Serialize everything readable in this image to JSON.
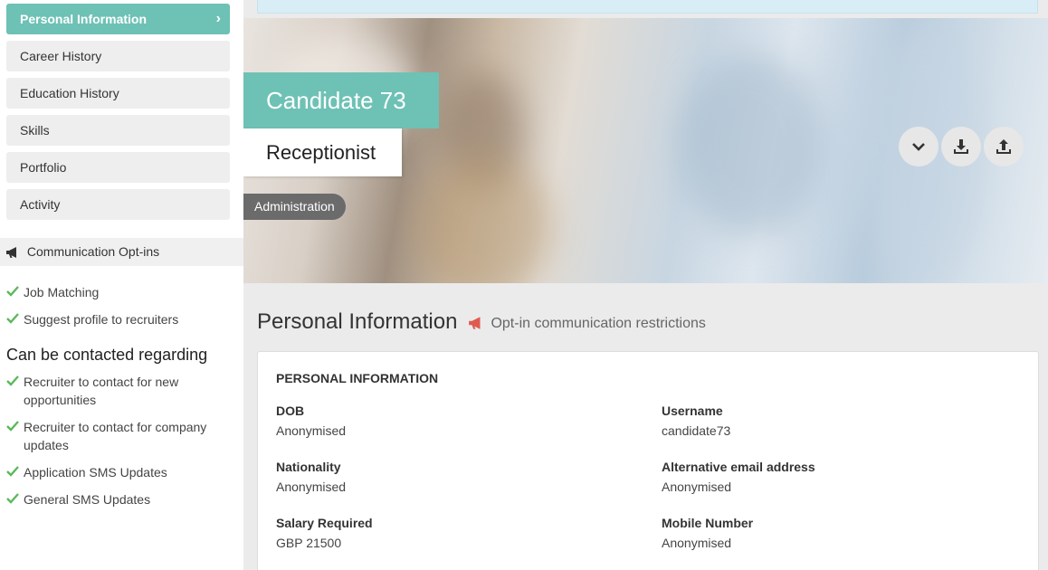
{
  "sidebar": {
    "nav": [
      {
        "label": "Personal Information",
        "active": true
      },
      {
        "label": "Career History",
        "active": false
      },
      {
        "label": "Education History",
        "active": false
      },
      {
        "label": "Skills",
        "active": false
      },
      {
        "label": "Portfolio",
        "active": false
      },
      {
        "label": "Activity",
        "active": false
      }
    ],
    "optins_title": "Communication Opt-ins",
    "optins": [
      "Job Matching",
      "Suggest profile to recruiters"
    ],
    "contact_title": "Can be contacted regarding",
    "contact_items": [
      "Recruiter to contact for new opportunities",
      "Recruiter to contact for company updates",
      "Application SMS Updates",
      "General SMS Updates"
    ]
  },
  "hero": {
    "name": "Candidate 73",
    "role": "Receptionist",
    "tag": "Administration"
  },
  "section": {
    "title": "Personal Information",
    "subtitle": "Opt-in communication restrictions"
  },
  "card": {
    "title": "PERSONAL INFORMATION",
    "fields": [
      {
        "label": "DOB",
        "value": "Anonymised"
      },
      {
        "label": "Username",
        "value": "candidate73"
      },
      {
        "label": "Nationality",
        "value": "Anonymised"
      },
      {
        "label": "Alternative email address",
        "value": "Anonymised"
      },
      {
        "label": "Salary Required",
        "value": "GBP 21500"
      },
      {
        "label": "Mobile Number",
        "value": "Anonymised"
      }
    ]
  },
  "colors": {
    "accent": "#6ec1b5",
    "check": "#5cb85c",
    "megaphone": "#e05a4f",
    "pill": "#6b6b6b"
  }
}
